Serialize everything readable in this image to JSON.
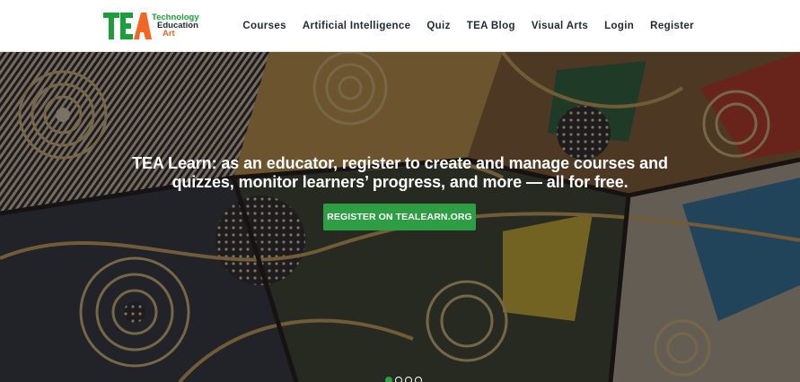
{
  "logo": {
    "letters": "TEA",
    "words": [
      "Technology",
      "Education",
      "Art"
    ],
    "colors": {
      "green": "#1e9e3a",
      "orange": "#f26522"
    }
  },
  "nav": {
    "items": [
      {
        "label": "Courses"
      },
      {
        "label": "Artificial Intelligence"
      },
      {
        "label": "Quiz"
      },
      {
        "label": "TEA Blog"
      },
      {
        "label": "Visual Arts"
      },
      {
        "label": "Login"
      },
      {
        "label": "Register"
      }
    ]
  },
  "hero": {
    "headline_line1": "TEA Learn: as an educator, register to create and manage courses and",
    "headline_line2": "quizzes, monitor learners’ progress, and more — all for free.",
    "cta_label": "REGISTER ON TEALEARN.ORG",
    "cta_color": "#2e9e45",
    "slider": {
      "count": 4,
      "active_index": 0
    }
  }
}
